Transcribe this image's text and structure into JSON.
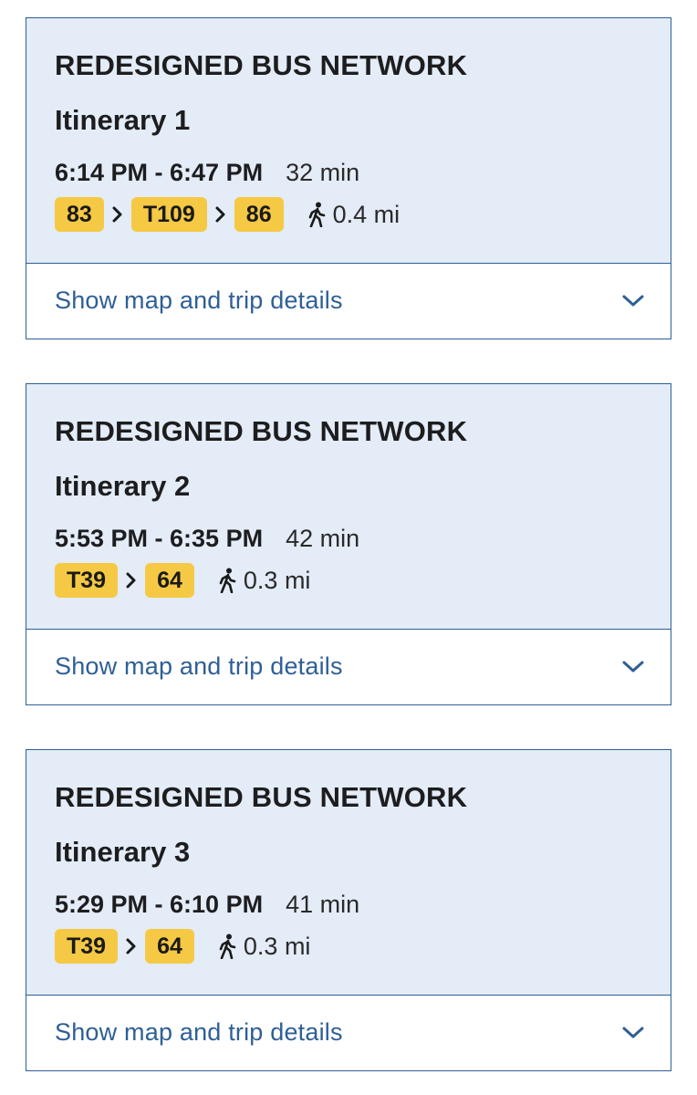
{
  "cards": [
    {
      "network": "REDESIGNED BUS NETWORK",
      "title": "Itinerary 1",
      "time_range": "6:14 PM - 6:47 PM",
      "duration": "32 min",
      "routes": [
        "83",
        "T109",
        "86"
      ],
      "walk": "0.4 mi",
      "details_label": "Show map and trip details"
    },
    {
      "network": "REDESIGNED BUS NETWORK",
      "title": "Itinerary 2",
      "time_range": "5:53 PM - 6:35 PM",
      "duration": "42 min",
      "routes": [
        "T39",
        "64"
      ],
      "walk": "0.3 mi",
      "details_label": "Show map and trip details"
    },
    {
      "network": "REDESIGNED BUS NETWORK",
      "title": "Itinerary 3",
      "time_range": "5:29 PM - 6:10 PM",
      "duration": "41 min",
      "routes": [
        "T39",
        "64"
      ],
      "walk": "0.3 mi",
      "details_label": "Show map and trip details"
    }
  ],
  "icons": {
    "route_separator": "chevron-right-icon",
    "walk": "walking-person-icon",
    "expand": "chevron-down-icon"
  },
  "colors": {
    "card_header_bg": "#e3ecf7",
    "border": "#2e5f96",
    "link_text": "#2e5f96",
    "route_badge": "#f6c944"
  }
}
